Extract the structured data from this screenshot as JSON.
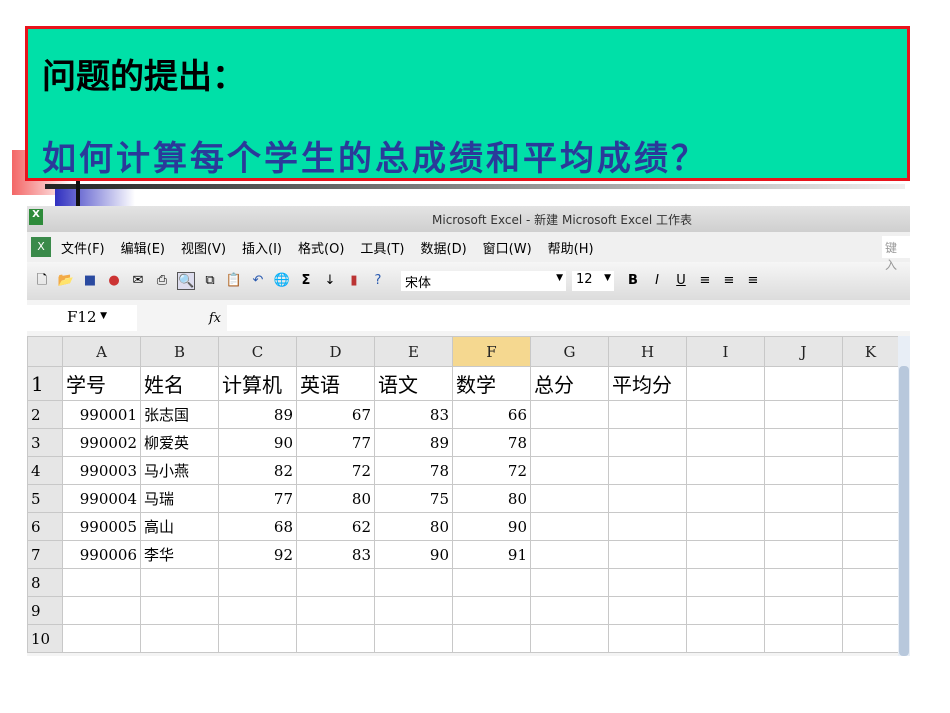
{
  "slide": {
    "heading": "问题的提出：",
    "question": "如何计算每个学生的总成绩和平均成绩？"
  },
  "excel": {
    "title": "Microsoft Excel - 新建 Microsoft Excel 工作表",
    "menu": [
      "文件(F)",
      "编辑(E)",
      "视图(V)",
      "插入(I)",
      "格式(O)",
      "工具(T)",
      "数据(D)",
      "窗口(W)",
      "帮助(H)"
    ],
    "help_hint": "键入",
    "font": "宋体",
    "font_size": "12",
    "name_box": "F12",
    "fx": "fx",
    "columns": [
      "A",
      "B",
      "C",
      "D",
      "E",
      "F",
      "G",
      "H",
      "I",
      "J",
      "K"
    ],
    "rows": [
      [
        "学号",
        "姓名",
        "计算机",
        "英语",
        "语文",
        "数学",
        "总分",
        "平均分",
        "",
        "",
        ""
      ],
      [
        "990001",
        "张志国",
        "89",
        "67",
        "83",
        "66",
        "",
        "",
        "",
        "",
        ""
      ],
      [
        "990002",
        "柳爱英",
        "90",
        "77",
        "89",
        "78",
        "",
        "",
        "",
        "",
        ""
      ],
      [
        "990003",
        "马小燕",
        "82",
        "72",
        "78",
        "72",
        "",
        "",
        "",
        "",
        ""
      ],
      [
        "990004",
        "马瑞",
        "77",
        "80",
        "75",
        "80",
        "",
        "",
        "",
        "",
        ""
      ],
      [
        "990005",
        "高山",
        "68",
        "62",
        "80",
        "90",
        "",
        "",
        "",
        "",
        ""
      ],
      [
        "990006",
        "李华",
        "92",
        "83",
        "90",
        "91",
        "",
        "",
        "",
        "",
        ""
      ],
      [
        "",
        "",
        "",
        "",
        "",
        "",
        "",
        "",
        "",
        "",
        ""
      ],
      [
        "",
        "",
        "",
        "",
        "",
        "",
        "",
        "",
        "",
        "",
        ""
      ],
      [
        "",
        "",
        "",
        "",
        "",
        "",
        "",
        "",
        "",
        "",
        ""
      ]
    ]
  }
}
